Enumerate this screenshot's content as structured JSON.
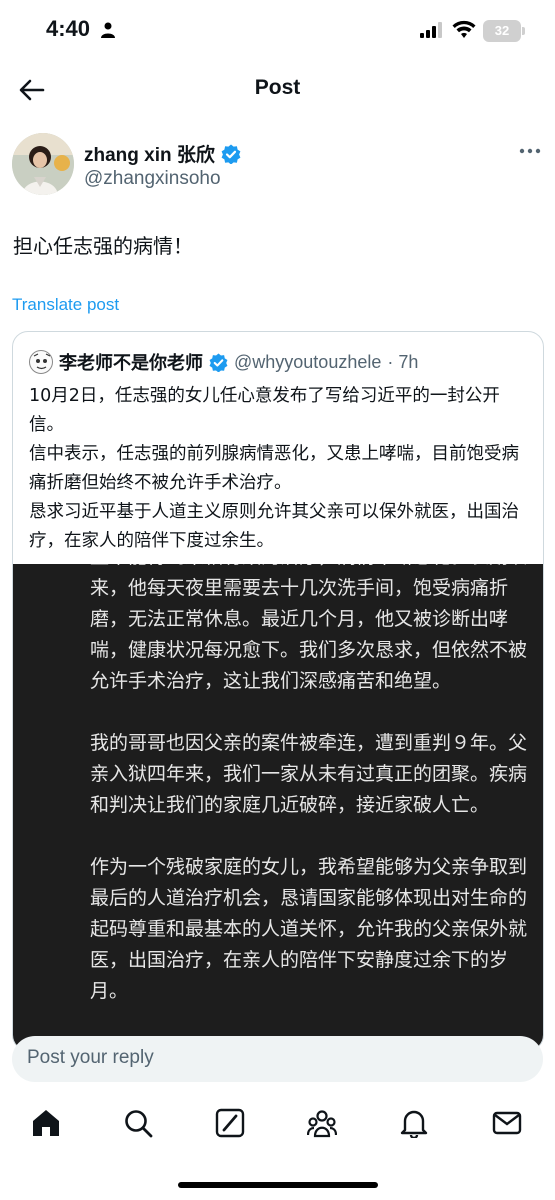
{
  "status_bar": {
    "time": "4:40",
    "battery": "32"
  },
  "header": {
    "title": "Post"
  },
  "author": {
    "name": "zhang xin 张欣",
    "handle": "@zhangxinsoho"
  },
  "post": {
    "text": "担心任志强的病情！",
    "translate_label": "Translate post"
  },
  "quote": {
    "name": "李老师不是你老师",
    "handle": "@whyyoutouzhele",
    "time": "· 7h",
    "paragraphs": [
      "10月2日，任志强的女儿任心意发布了写给习近平的一封公开信。",
      "信中表示，任志强的前列腺病情恶化，又患上哮喘，目前饱受病痛折磨但始终不被允许手术治疗。",
      "恳求习近平基于人道主义原则允许其父亲可以保外就医，出国治疗，在家人的陪伴下度过余生。"
    ],
    "image_paragraphs": [
      "直未能得到来相有效的治疗，病情不断恶化。长期以来，他每天夜里需要去十几次洗手间，饱受病痛折磨，无法正常休息。最近几个月，他又被诊断出哮喘，健康状况每况愈下。我们多次恳求，但依然不被允许手术治疗，这让我们深感痛苦和绝望。",
      "我的哥哥也因父亲的案件被牵连，遭到重判９年。父亲入狱四年来，我们一家从未有过真正的团聚。疾病和判决让我们的家庭几近破碎，接近家破人亡。",
      "作为一个残破家庭的女儿，我希望能够为父亲争取到最后的人道治疗机会，恳请国家能够体现出对生命的起码尊重和最基本的人道关怀，允许我的父亲保外就医，出国治疗，在亲人的陪伴下安静度过余下的岁月。"
    ]
  },
  "reply": {
    "placeholder": "Post your reply"
  },
  "tabs": [
    "home-icon",
    "search-icon",
    "grok-icon",
    "communities-icon",
    "notifications-icon",
    "messages-icon"
  ],
  "colors": {
    "accent": "#1d9bf0",
    "verified": "#1d9bf0",
    "muted": "#536471"
  }
}
